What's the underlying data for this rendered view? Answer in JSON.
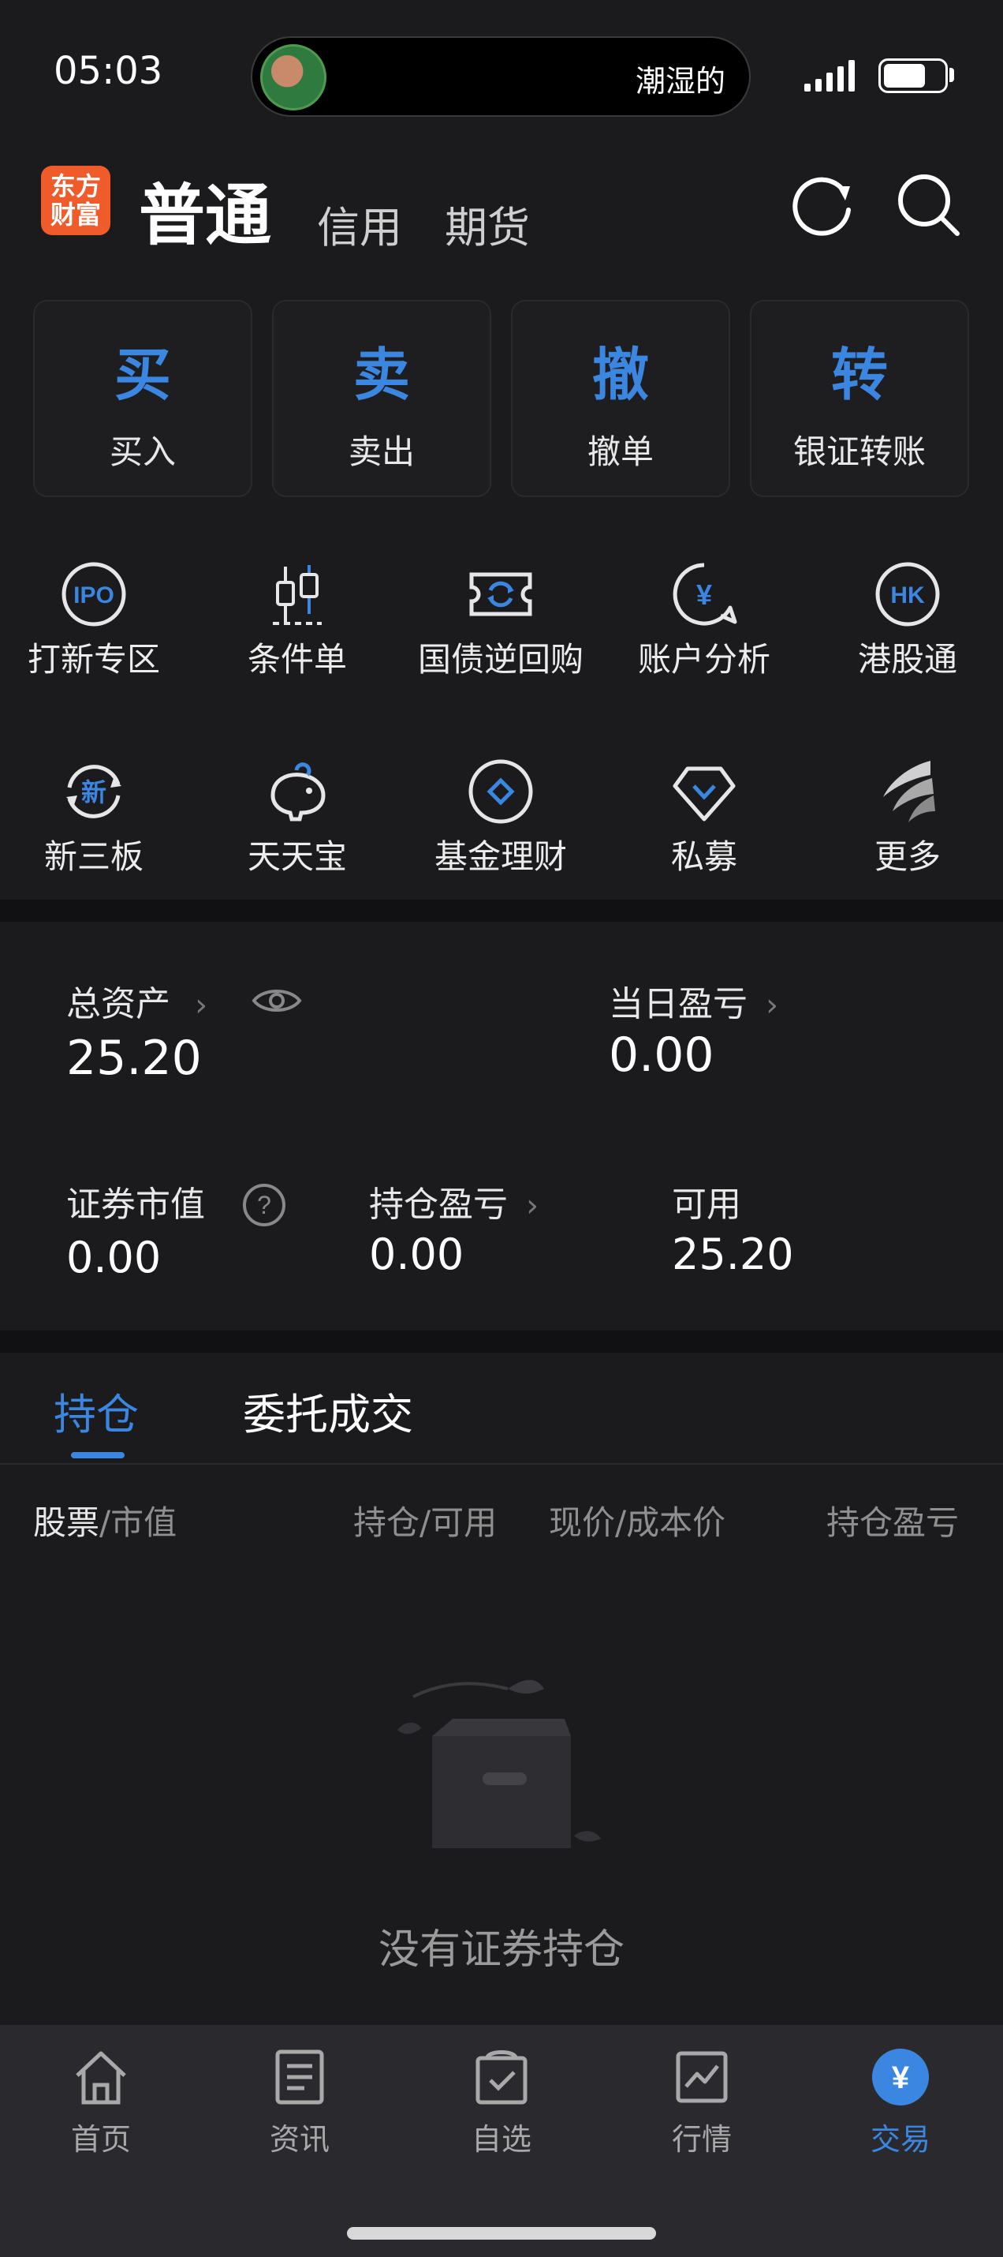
{
  "status_bar": {
    "time": "05:03",
    "island_text": "潮湿的"
  },
  "header": {
    "logo_text": "东方财富",
    "tabs": [
      {
        "label": "普通"
      },
      {
        "label": "信用"
      },
      {
        "label": "期货"
      }
    ]
  },
  "quick_actions": [
    {
      "big": "买",
      "label": "买入"
    },
    {
      "big": "卖",
      "label": "卖出"
    },
    {
      "big": "撤",
      "label": "撤单"
    },
    {
      "big": "转",
      "label": "银证转账"
    }
  ],
  "grid_row1": [
    {
      "label": "打新专区",
      "icon": "ipo-icon",
      "icon_text": "IPO"
    },
    {
      "label": "条件单",
      "icon": "candlestick-icon"
    },
    {
      "label": "国债逆回购",
      "icon": "ticket-cycle-icon"
    },
    {
      "label": "账户分析",
      "icon": "yuan-chat-icon",
      "icon_text": "¥"
    },
    {
      "label": "港股通",
      "icon": "hk-icon",
      "icon_text": "HK"
    }
  ],
  "grid_row2": [
    {
      "label": "新三板",
      "icon": "new-board-icon",
      "icon_text": "新"
    },
    {
      "label": "天天宝",
      "icon": "piggy-bank-icon"
    },
    {
      "label": "基金理财",
      "icon": "fund-diamond-icon"
    },
    {
      "label": "私募",
      "icon": "private-fund-icon"
    },
    {
      "label": "更多",
      "icon": "more-logo-icon"
    }
  ],
  "assets": {
    "total_label": "总资产",
    "total_value": "25.20",
    "daily_pnl_label": "当日盈亏",
    "daily_pnl_value": "0.00",
    "market_value_label": "证券市值",
    "market_value_value": "0.00",
    "position_pnl_label": "持仓盈亏",
    "position_pnl_value": "0.00",
    "available_label": "可用",
    "available_value": "25.20"
  },
  "positions": {
    "tabs": [
      {
        "label": "持仓"
      },
      {
        "label": "委托成交"
      }
    ],
    "columns": {
      "stock": "股票",
      "stock_sub": "/市值",
      "hold": "持仓/可用",
      "price": "现价/成本价",
      "pnl": "持仓盈亏"
    },
    "empty_text": "没有证券持仓"
  },
  "bottom_nav": [
    {
      "label": "首页",
      "icon": "home-icon"
    },
    {
      "label": "资讯",
      "icon": "news-icon"
    },
    {
      "label": "自选",
      "icon": "watchlist-icon"
    },
    {
      "label": "行情",
      "icon": "market-chart-icon"
    },
    {
      "label": "交易",
      "icon": "trade-yuan-icon",
      "icon_text": "¥"
    }
  ],
  "colors": {
    "accent": "#3a86e0",
    "logo": "#ef5b2a",
    "background": "#1b1b1d"
  }
}
